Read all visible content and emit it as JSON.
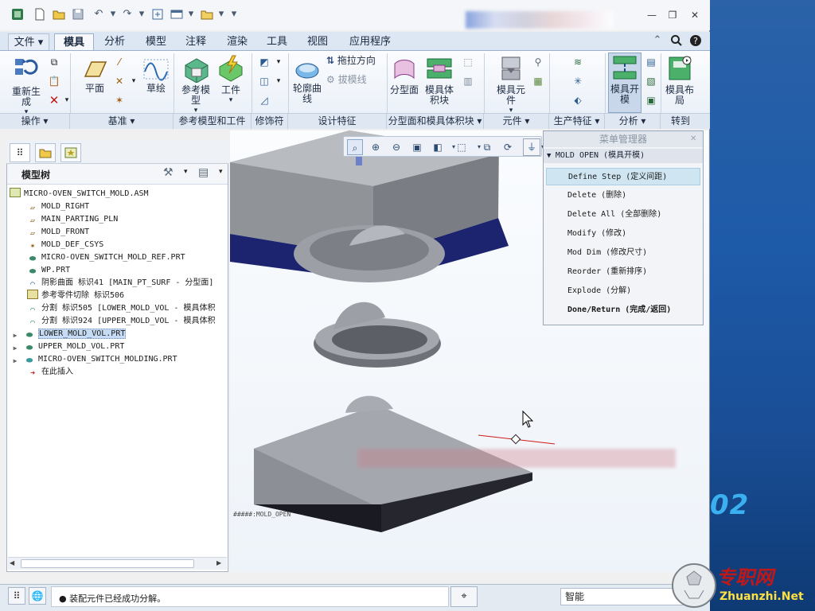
{
  "ribbon_tabs": [
    {
      "label": "文件"
    },
    {
      "label": "模具"
    },
    {
      "label": "分析"
    },
    {
      "label": "模型"
    },
    {
      "label": "注释"
    },
    {
      "label": "渲染"
    },
    {
      "label": "工具"
    },
    {
      "label": "视图"
    },
    {
      "label": "应用程序"
    }
  ],
  "ribbon": {
    "regen": "重新生成",
    "plane": "平面",
    "sketch": "草绘",
    "ref_model": "参考模型",
    "workpiece": "工件",
    "contour_curve": "轮廓曲线",
    "pull_direction": "拖拉方向",
    "draft_line": "拔模线",
    "parting_surface": "分型面",
    "mold_volume": "模具体积块",
    "mold_component": "模具元件",
    "mold_open": "模具开模",
    "mold_layout": "模具布局"
  },
  "groups": [
    {
      "label": "操作"
    },
    {
      "label": "基准"
    },
    {
      "label": "参考模型和工件"
    },
    {
      "label": "修饰符"
    },
    {
      "label": "设计特征"
    },
    {
      "label": "分型面和模具体积块"
    },
    {
      "label": "元件"
    },
    {
      "label": "生产特征"
    },
    {
      "label": "分析"
    },
    {
      "label": "转到"
    }
  ],
  "tree": {
    "title": "模型树",
    "rows": [
      {
        "icon": "assembly-icon",
        "text": "MICRO-OVEN_SWITCH_MOLD.ASM"
      },
      {
        "icon": "datum-plane-icon",
        "text": "MOLD_RIGHT"
      },
      {
        "icon": "datum-plane-icon",
        "text": "MAIN_PARTING_PLN"
      },
      {
        "icon": "datum-plane-icon",
        "text": "MOLD_FRONT"
      },
      {
        "icon": "csys-icon",
        "text": "MOLD_DEF_CSYS"
      },
      {
        "icon": "part-icon",
        "text": "MICRO-OVEN_SWITCH_MOLD_REF.PRT"
      },
      {
        "icon": "part-icon",
        "text": "WP.PRT"
      },
      {
        "icon": "surface-icon",
        "text": "阴影曲面 标识41 [MAIN_PT_SURF - 分型面]"
      },
      {
        "icon": "cut-icon",
        "text": "参考零件切除 标识506"
      },
      {
        "icon": "split-icon",
        "text": "分割 标识505 [LOWER_MOLD_VOL - 模具体积"
      },
      {
        "icon": "split-icon",
        "text": "分割 标识924 [UPPER_MOLD_VOL - 模具体积"
      },
      {
        "icon": "part-icon",
        "text": "LOWER_MOLD_VOL.PRT",
        "expand": "▶",
        "selected": true
      },
      {
        "icon": "part-icon",
        "text": "UPPER_MOLD_VOL.PRT",
        "expand": "▶"
      },
      {
        "icon": "part-icon",
        "text": "MICRO-OVEN_SWITCH_MOLDING.PRT",
        "expand": "▶"
      },
      {
        "icon": "insert-here-icon",
        "text": "在此插入"
      }
    ]
  },
  "menu": {
    "title": "菜单管理器",
    "header": "MOLD OPEN (模具开模)",
    "items": [
      {
        "label": "Define Step (定义间距)",
        "highlighted": true
      },
      {
        "label": "Delete (删除)"
      },
      {
        "label": "Delete All (全部删除)"
      },
      {
        "label": "Modify (修改)"
      },
      {
        "label": "Mod Dim (修改尺寸)"
      },
      {
        "label": "Reorder (重新排序)"
      },
      {
        "label": "Explode (分解)"
      },
      {
        "label": "Done/Return (完成/返回)",
        "bold": true
      }
    ]
  },
  "viewport": {
    "model_label": "#####:MOLD_OPEN"
  },
  "status": {
    "message": "● 装配元件已经成功分解。",
    "filter": "智能"
  },
  "desktop": {
    "number": "02"
  },
  "watermark": {
    "name": "专职网",
    "url": "Zhuanzhi.Net"
  },
  "colors": {
    "accent": "#3a72b8",
    "mold_body": "#8c9096",
    "mold_bottom": "#1e2a78",
    "highlight": "#cfe6f2"
  }
}
